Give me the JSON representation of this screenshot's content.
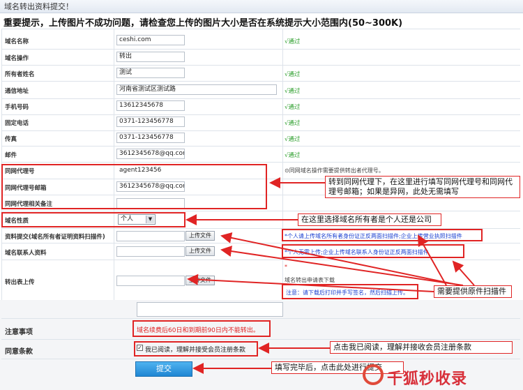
{
  "window_title": "域名转出资料提交！",
  "notice": "重要提示，上传图片不成功问题，请检查您上传的图片大小是否在系统提示大小范围内(50~300K)",
  "rows": [
    {
      "label": "域名名称",
      "value": "ceshi.com",
      "status": "√通过"
    },
    {
      "label": "域名操作",
      "value": "转出",
      "status": ""
    },
    {
      "label": "所有者姓名",
      "value": "测试",
      "status": "√通过"
    },
    {
      "label": "通信地址",
      "value": "河南省测试区测试路",
      "status": "√通过"
    },
    {
      "label": "手机号码",
      "value": "13612345678",
      "status": "√通过"
    },
    {
      "label": "固定电话",
      "value": "0371-123456778",
      "status": "√通过"
    },
    {
      "label": "传真",
      "value": "0371-123456778",
      "status": "√通过"
    },
    {
      "label": "邮件",
      "value": "3612345678@qq.com",
      "status": "√通过"
    }
  ],
  "agent_rows": [
    {
      "label": "同网代理号",
      "value": "agent123456"
    },
    {
      "label": "同网代理号邮箱",
      "value": "3612345678@qq.com"
    },
    {
      "label": "同网代理相关备注",
      "value": ""
    }
  ],
  "agent_hint": "⊙同网域名操作需要提供转出者代理号。",
  "nature_label": "域名性质",
  "nature_value": "个人",
  "upload_rows": [
    {
      "label": "资料提交(域名所有者证明资料扫描件)",
      "button": "上传文件",
      "note": "*个人请上传域名所有者身份证正反两面扫描件;企业上传营业执照扫描件"
    },
    {
      "label": "域名联系人资料",
      "button": "上传文件",
      "note": "*个人无需上传;企业上传域名联系人身份证正反两面扫描件"
    }
  ],
  "transfer_label": "转出表上传",
  "transfer_button": "上传文件",
  "transfer_star": "*",
  "transfer_download": "域名转出申请表下载",
  "transfer_note": "注意：请下载后打印并手写签名，然后扫描上传。",
  "notes_label": "注意事项",
  "notes_text": "域名续费后60日和到期前90日内不能转出。",
  "terms_label": "同意条款",
  "terms_text": "我已阅读，理解并接受会员注册条款",
  "submit_label": "提交",
  "callouts": {
    "agent": "转到同网代理下，在这里进行填写同网代理号和同网代理号邮箱；如果是异网，此处无需填写",
    "nature": "在这里选择域名所有者是个人还是公司",
    "scan": "需要提供原件扫描件",
    "terms": "点击我已阅读，理解并接收会员注册条款",
    "submit": "填写完毕后，点击此处进行提交"
  },
  "watermark": "千狐秒收录",
  "colors": {
    "ok": "#2a9d2a",
    "annotation": "#e02424",
    "note_blue": "#1a3fd0",
    "button": "#1f86d3"
  }
}
